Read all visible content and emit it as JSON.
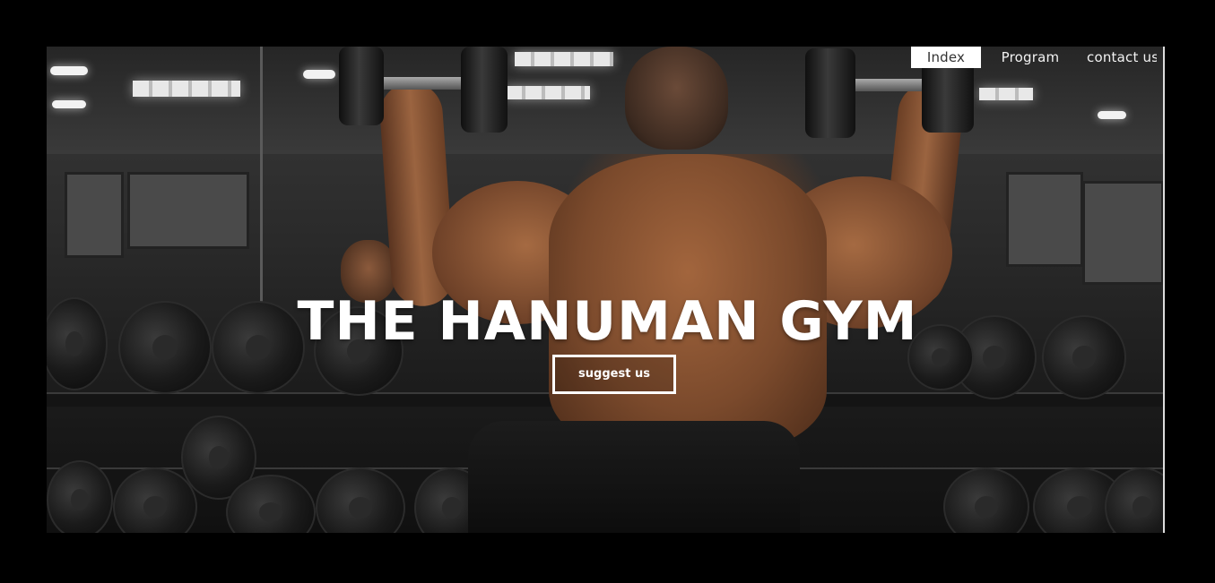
{
  "nav": {
    "items": [
      {
        "label": "Index",
        "active": true
      },
      {
        "label": "Program",
        "active": false
      },
      {
        "label": "contact us",
        "active": false
      }
    ]
  },
  "hero": {
    "title": "THE HANUMAN GYM",
    "cta_label": "suggest us",
    "image": "gym-bodybuilder-photo"
  },
  "colors": {
    "page_background": "#000000",
    "nav_active_background": "#ffffff",
    "text": "#ffffff"
  }
}
